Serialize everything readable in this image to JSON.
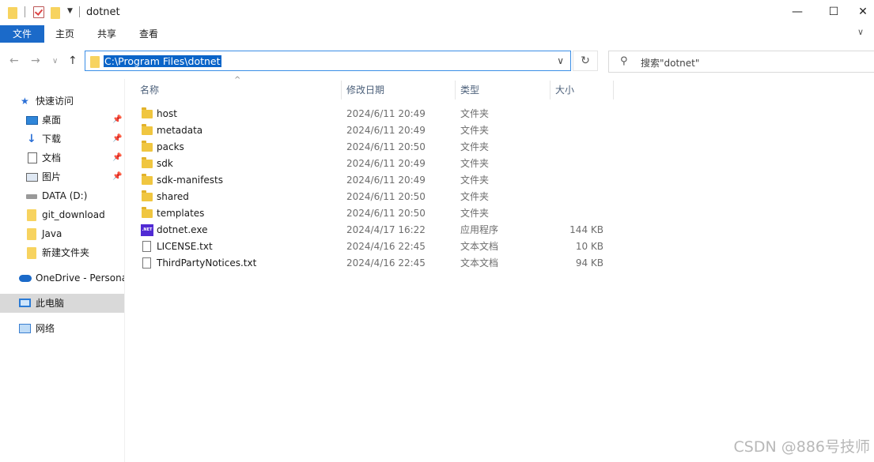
{
  "window": {
    "title": "dotnet",
    "controls": {
      "minimize": "—",
      "maximize": "☐",
      "close": "✕"
    }
  },
  "ribbon": {
    "tabs": [
      {
        "label": "文件",
        "active": true
      },
      {
        "label": "主页",
        "active": false
      },
      {
        "label": "共享",
        "active": false
      },
      {
        "label": "查看",
        "active": false
      }
    ]
  },
  "address": {
    "path": "C:\\Program Files\\dotnet",
    "search_placeholder": "搜索\"dotnet\""
  },
  "nav": {
    "items": [
      {
        "label": "快速访问",
        "icon": "star-icon",
        "pinned": false
      },
      {
        "label": "桌面",
        "icon": "desktop-icon",
        "pinned": true
      },
      {
        "label": "下载",
        "icon": "download-icon",
        "pinned": true
      },
      {
        "label": "文档",
        "icon": "document-icon",
        "pinned": true
      },
      {
        "label": "图片",
        "icon": "picture-icon",
        "pinned": true
      },
      {
        "label": "DATA (D:)",
        "icon": "drive-icon",
        "pinned": false
      },
      {
        "label": "git_download",
        "icon": "folder-icon",
        "pinned": false
      },
      {
        "label": "Java",
        "icon": "folder-icon",
        "pinned": false
      },
      {
        "label": "新建文件夹",
        "icon": "folder-icon",
        "pinned": false
      },
      {
        "label": "OneDrive - Persona",
        "icon": "cloud-icon",
        "pinned": false
      },
      {
        "label": "此电脑",
        "icon": "pc-icon",
        "pinned": false,
        "selected": true
      },
      {
        "label": "网络",
        "icon": "network-icon",
        "pinned": false
      }
    ]
  },
  "columns": {
    "name": "名称",
    "date": "修改日期",
    "type": "类型",
    "size": "大小"
  },
  "files": [
    {
      "name": "host",
      "date": "2024/6/11 20:49",
      "type": "文件夹",
      "size": "",
      "icon": "folder-icon"
    },
    {
      "name": "metadata",
      "date": "2024/6/11 20:49",
      "type": "文件夹",
      "size": "",
      "icon": "folder-icon"
    },
    {
      "name": "packs",
      "date": "2024/6/11 20:50",
      "type": "文件夹",
      "size": "",
      "icon": "folder-icon"
    },
    {
      "name": "sdk",
      "date": "2024/6/11 20:49",
      "type": "文件夹",
      "size": "",
      "icon": "folder-icon"
    },
    {
      "name": "sdk-manifests",
      "date": "2024/6/11 20:49",
      "type": "文件夹",
      "size": "",
      "icon": "folder-icon"
    },
    {
      "name": "shared",
      "date": "2024/6/11 20:50",
      "type": "文件夹",
      "size": "",
      "icon": "folder-icon"
    },
    {
      "name": "templates",
      "date": "2024/6/11 20:50",
      "type": "文件夹",
      "size": "",
      "icon": "folder-icon"
    },
    {
      "name": "dotnet.exe",
      "date": "2024/4/17 16:22",
      "type": "应用程序",
      "size": "144 KB",
      "icon": "exe-icon",
      "badge": ".NET"
    },
    {
      "name": "LICENSE.txt",
      "date": "2024/4/16 22:45",
      "type": "文本文档",
      "size": "10 KB",
      "icon": "text-file-icon"
    },
    {
      "name": "ThirdPartyNotices.txt",
      "date": "2024/4/16 22:45",
      "type": "文本文档",
      "size": "94 KB",
      "icon": "text-file-icon"
    }
  ],
  "watermark": "CSDN @886号技师"
}
